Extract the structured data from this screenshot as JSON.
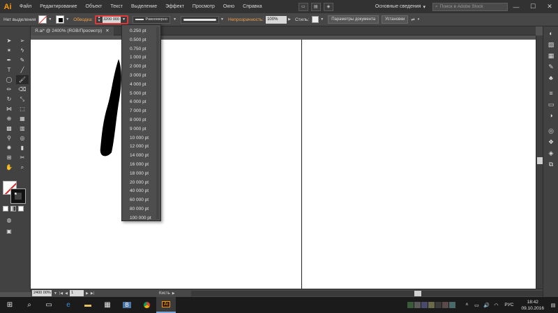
{
  "menubar": {
    "logo": "Ai",
    "items": [
      "Файл",
      "Редактирование",
      "Объект",
      "Текст",
      "Выделение",
      "Эффект",
      "Просмотр",
      "Окно",
      "Справка"
    ],
    "workspace": "Основные сведения",
    "stock_search_placeholder": "Поиск в Adobe Stock",
    "win_min": "—",
    "win_max": "☐",
    "win_close": "✕"
  },
  "controlbar": {
    "selection_label": "Нет выделения",
    "stroke_label": "Обводка:",
    "stroke_value": "3200 000",
    "profile_label": "Равномерно",
    "opacity_label": "Непрозрачность:",
    "opacity_value": "100%",
    "styles_label": "Стиль:",
    "doc_params_button": "Параметры документа",
    "settings_button": "Установки"
  },
  "document": {
    "tab_title": "Я.ai* @ 2400% (RGB/Просмотр)",
    "tab_close": "✕"
  },
  "status": {
    "zoom": "2400 00%",
    "page": "1",
    "tool_name": "Кисть"
  },
  "dropdown": {
    "options": [
      "0.250 pt",
      "0.500 pt",
      "0.750 pt",
      "1 000 pt",
      "2 000 pt",
      "3 000 pt",
      "4 000 pt",
      "5 000 pt",
      "6 000 pt",
      "7 000 pt",
      "8 000 pt",
      "9 000 pt",
      "10 000 pt",
      "12 000 pt",
      "14 000 pt",
      "16 000 pt",
      "18 000 pt",
      "20 000 pt",
      "40 000 pt",
      "60 000 pt",
      "80 000 pt",
      "100 000 pt"
    ]
  },
  "taskbar": {
    "lang": "РУС",
    "time": "18:42",
    "date": "09.10.2016"
  }
}
